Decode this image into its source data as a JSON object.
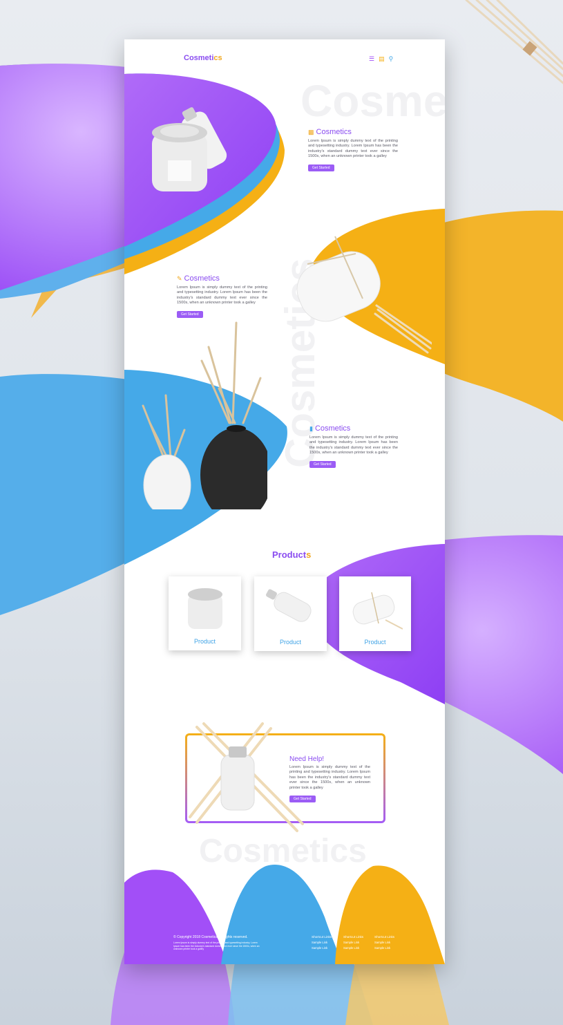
{
  "brand": {
    "name_main": "Cosmeti",
    "name_accent": "cs"
  },
  "nav": {
    "menu_icon": "menu-icon",
    "cart_icon": "cart-icon",
    "search_icon": "search-icon"
  },
  "watermarks": {
    "top": "Cosmetics",
    "side": "Cosmetics",
    "bottom": "Cosmetics"
  },
  "sections": [
    {
      "icon": "bottle-icon",
      "title": "Cosmetics",
      "body": "Lorem Ipsum is simply dummy text of the printing and typesetting industry. Lorem Ipsum has been the industry's standard dummy text ever since the 1500s, when an unknown printer took a galley",
      "button": "Get Started"
    },
    {
      "icon": "brush-icon",
      "title": "Cosmetics",
      "body": "Lorem Ipsum is simply dummy text of the printing and typesetting industry. Lorem Ipsum has been the industry's standard dummy text ever since the 1500s, when an unknown printer took a galley",
      "button": "Get Started"
    },
    {
      "icon": "tube-icon",
      "title": "Cosmetics",
      "body": "Lorem Ipsum is simply dummy text of the printing and typesetting industry. Lorem Ipsum has been the industry's standard dummy text ever since the 1500s, when an unknown printer took a galley",
      "button": "Get Started"
    }
  ],
  "products": {
    "title_main": "Product",
    "title_accent": "s",
    "items": [
      {
        "label": "Product"
      },
      {
        "label": "Product"
      },
      {
        "label": "Product"
      }
    ]
  },
  "help": {
    "title": "Need Help!",
    "body": "Lorem Ipsum is simply dummy text of the printing and typesetting industry. Lorem Ipsum has been the industry's standard dummy text ever since the 1500s, when an unknown printer took a galley",
    "button": "Get Started"
  },
  "footer": {
    "copyright": "© Copyright 2018 Cosmetics. All rights reserved.",
    "small": "Lorem Ipsum is simply dummy text of the printing and typesetting industry. Lorem Ipsum has been the industry's standard dummy text ever since the 1500s, when an unknown printer took a galley",
    "columns": [
      {
        "heading": "Shortcut Links",
        "links": [
          "Sample Link",
          "Sample Link"
        ]
      },
      {
        "heading": "Shortcut Links",
        "links": [
          "Sample Link",
          "Sample Link"
        ]
      },
      {
        "heading": "Shortcut Links",
        "links": [
          "Sample Link",
          "Sample Link"
        ]
      }
    ]
  },
  "colors": {
    "purple": "#a24ff7",
    "blue": "#45a9e8",
    "yellow": "#f5b015"
  }
}
